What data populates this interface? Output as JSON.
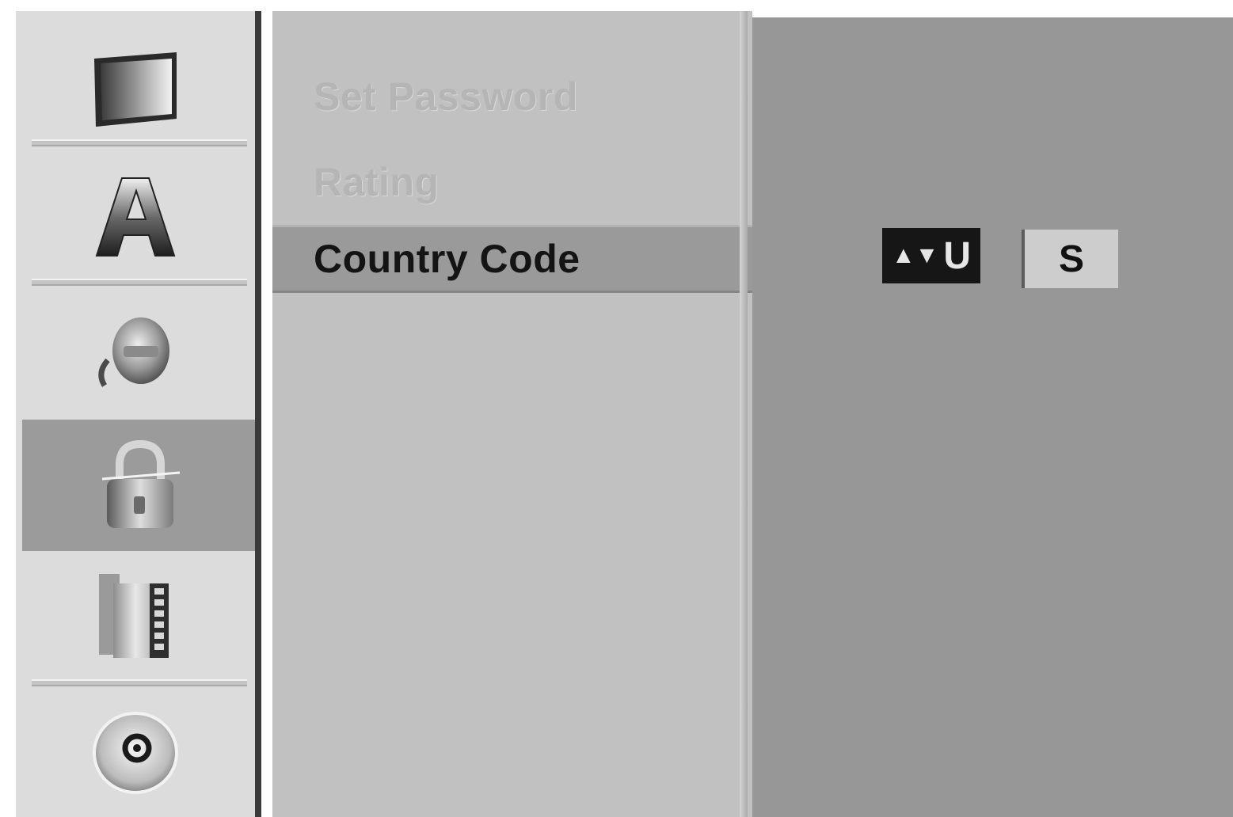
{
  "sidebar": {
    "items": [
      {
        "icon": "tv-screen-icon",
        "active": false
      },
      {
        "icon": "letter-a-icon",
        "active": false
      },
      {
        "icon": "speaker-audio-icon",
        "active": false
      },
      {
        "icon": "lock-icon",
        "active": true
      },
      {
        "icon": "film-strip-icon",
        "active": false
      },
      {
        "icon": "disc-icon",
        "active": false
      }
    ]
  },
  "menu": {
    "items": [
      {
        "label": "Set Password",
        "state": "disabled"
      },
      {
        "label": "Rating",
        "state": "disabled"
      },
      {
        "label": "Country Code",
        "state": "selected"
      }
    ]
  },
  "country_code": {
    "adjust_arrows": "▲▼",
    "char1": "U",
    "char2": "S"
  },
  "colors": {
    "selected_row": "#9a9a9a",
    "panel_bg": "#979797",
    "menu_bg": "#c1c1c1",
    "sidebar_bg": "#dcdcdc"
  }
}
